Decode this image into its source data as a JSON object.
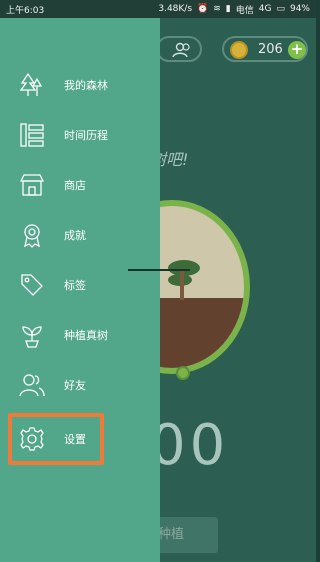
{
  "statusbar": {
    "time": "上午6:03",
    "speed": "3.48K/s",
    "carrier": "电信",
    "network": "4G",
    "battery": "94%"
  },
  "app": {
    "coin_count": "206",
    "slogan": "树吧!",
    "timer": "00",
    "plant_button": "种植"
  },
  "drawer": {
    "items": [
      {
        "label": "我的森林",
        "icon": "forest-icon"
      },
      {
        "label": "时间历程",
        "icon": "timeline-icon"
      },
      {
        "label": "商店",
        "icon": "store-icon"
      },
      {
        "label": "成就",
        "icon": "achievement-icon"
      },
      {
        "label": "标签",
        "icon": "tag-icon"
      },
      {
        "label": "种植真树",
        "icon": "sprout-icon"
      },
      {
        "label": "好友",
        "icon": "friends-icon"
      },
      {
        "label": "设置",
        "icon": "gear-icon"
      }
    ]
  },
  "colors": {
    "drawer_bg": "#52a78a",
    "highlight": "#ef7a3a"
  }
}
